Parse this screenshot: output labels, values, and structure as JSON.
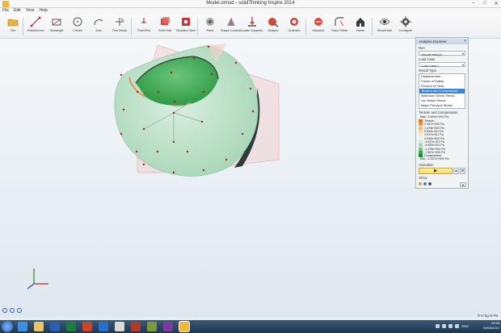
{
  "window": {
    "title": "Model.stmod - solidThinking Inspire 2014"
  },
  "menu": [
    "File",
    "Edit",
    "View",
    "Help"
  ],
  "toolbar": [
    {
      "label": "File",
      "icon": "folder-icon"
    },
    {
      "label": "Points/Lines",
      "icon": "points-lines-icon"
    },
    {
      "label": "Rectangle",
      "icon": "rectangle-icon"
    },
    {
      "label": "Circles",
      "icon": "circle-icon"
    },
    {
      "label": "Arcs",
      "icon": "arc-icon"
    },
    {
      "label": "Trim Break",
      "icon": "trim-icon"
    },
    {
      "label": "Push/Pull",
      "icon": "push-pull-icon"
    },
    {
      "label": "Solid Edit",
      "icon": "solid-edit-icon"
    },
    {
      "label": "Simplify Patch",
      "icon": "simplify-icon"
    },
    {
      "label": "Parts",
      "icon": "parts-icon"
    },
    {
      "label": "Shape Controls",
      "icon": "shape-controls-icon"
    },
    {
      "label": "Loads Supports",
      "icon": "loads-icon"
    },
    {
      "label": "Analyze",
      "icon": "analyze-icon"
    },
    {
      "label": "Optimize",
      "icon": "optimize-icon"
    },
    {
      "label": "Measure",
      "icon": "measure-icon"
    },
    {
      "label": "Trace Fillets",
      "icon": "fillets-icon"
    },
    {
      "label": "Home",
      "icon": "home-icon"
    },
    {
      "label": "Show/Hide",
      "icon": "eye-icon"
    },
    {
      "label": "Configure",
      "icon": "gear-icon"
    }
  ],
  "panel": {
    "title": "Analysis Explorer",
    "run_label": "Run",
    "run_value": "circular disc(1)",
    "loadcase_label": "Load Case",
    "loadcase_value": "Load Case 1",
    "result_type_label": "Result Type",
    "result_types": [
      "Displacement",
      "Factor of Safety",
      "Percent of Yield",
      "Tension and Compression",
      "Maximum Shear Stress",
      "von Mises Stress",
      "Major Principal Stress"
    ],
    "selected_result_index": 3,
    "legend_title": "Tension and Compression",
    "legend_max": "Max: 2.494e+000 Pa",
    "legend_min": "Min: -2.237e+000 Pa",
    "legend_rows": [
      {
        "label": "Tension",
        "color": "#e2771e"
      },
      {
        "label": "1.967e+000 Pa",
        "color": "#ea9b4a"
      },
      {
        "label": "1.475e+000 Pa",
        "color": "#f0bb80"
      },
      {
        "label": "9.833e-001 Pa",
        "color": "#f6d7b4"
      },
      {
        "label": "4.917e-001 Pa",
        "color": "#f8e8d6"
      },
      {
        "label": "0.000e+000 Pa",
        "color": "#e9f3ea"
      },
      {
        "label": "-4.917e-001 Pa",
        "color": "#cfe8d1"
      },
      {
        "label": "-9.833e-001 Pa",
        "color": "#a7d8ad"
      },
      {
        "label": "-1.475e+000 Pa",
        "color": "#74c27f"
      },
      {
        "label": "-1.967e+000 Pa",
        "color": "#3fa550"
      },
      {
        "label": "Compression",
        "color": "#1f8a34"
      }
    ],
    "animation_label": "Animation",
    "show_label": "Show"
  },
  "units": "ft  m  kg N Pa",
  "taskbar": {
    "time": "22:56",
    "date": "26/06/2014",
    "lang": "ENG"
  }
}
